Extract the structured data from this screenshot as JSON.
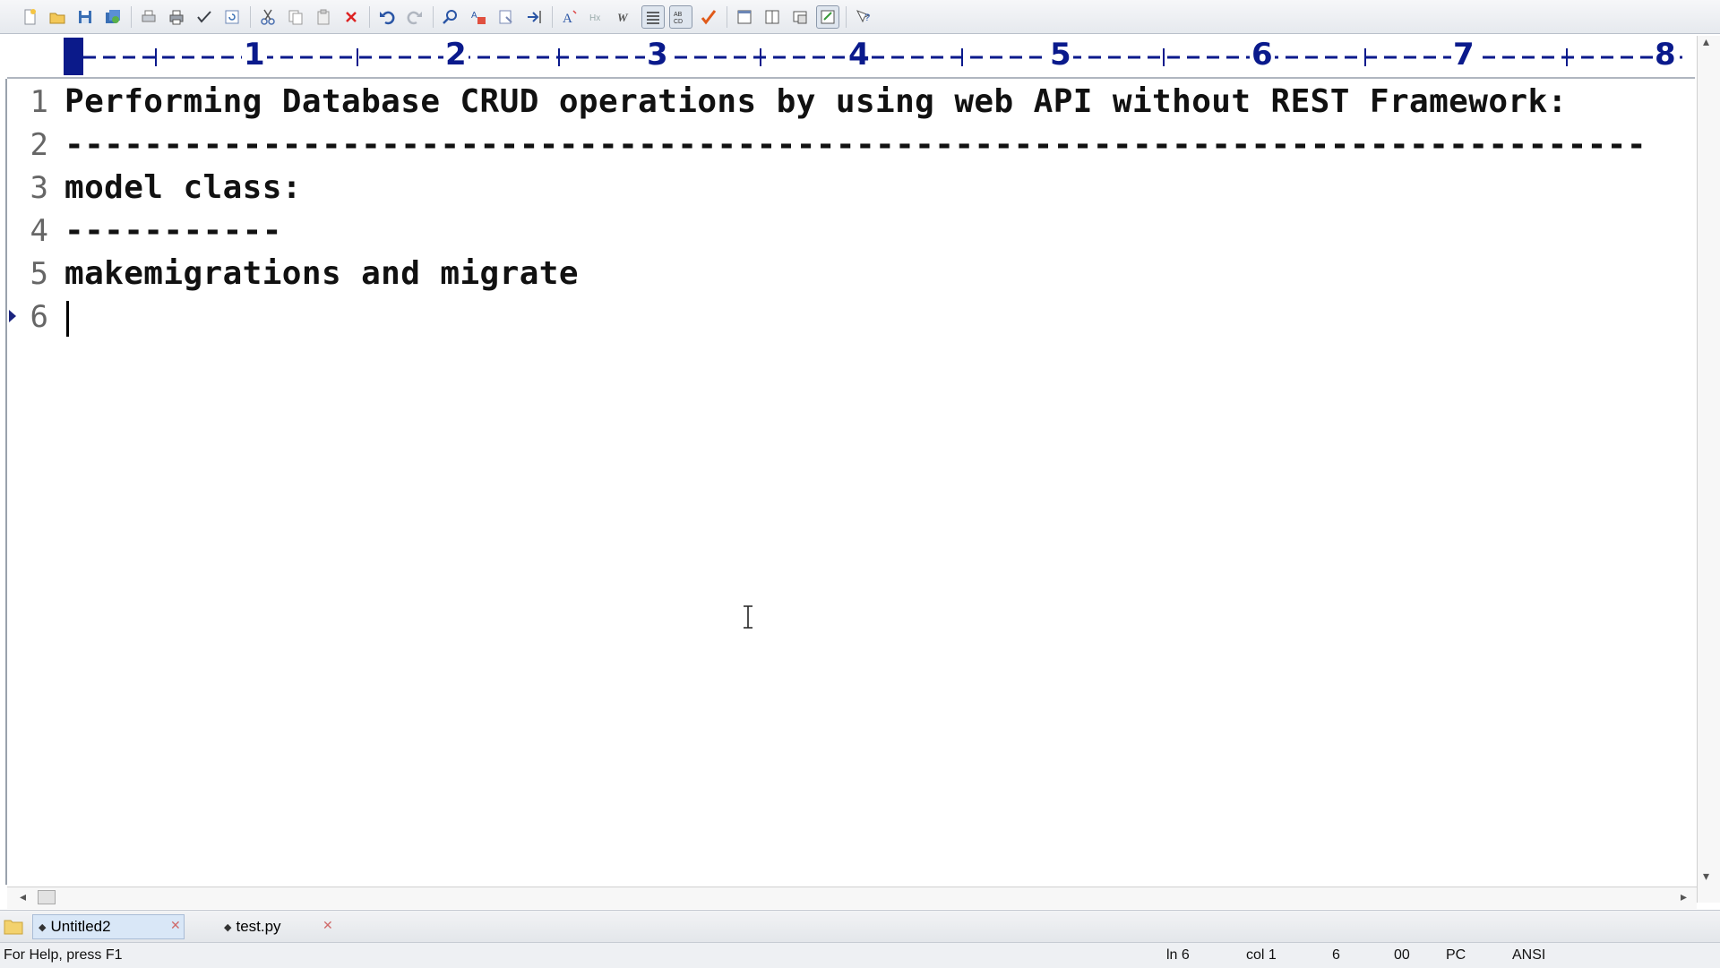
{
  "toolbar": {
    "buttons": [
      {
        "name": "new-file-icon"
      },
      {
        "name": "open-folder-icon"
      },
      {
        "name": "save-icon"
      },
      {
        "name": "save-all-icon"
      },
      {
        "name": "print-preview-icon"
      },
      {
        "name": "print-icon"
      },
      {
        "name": "spell-check-icon"
      },
      {
        "name": "refresh-icon"
      },
      {
        "name": "cut-icon"
      },
      {
        "name": "copy-icon"
      },
      {
        "name": "paste-icon"
      },
      {
        "name": "delete-icon"
      },
      {
        "name": "undo-icon"
      },
      {
        "name": "redo-icon"
      },
      {
        "name": "find-icon"
      },
      {
        "name": "replace-icon"
      },
      {
        "name": "find-in-files-icon"
      },
      {
        "name": "goto-line-icon"
      },
      {
        "name": "font-icon"
      },
      {
        "name": "hex-icon"
      },
      {
        "name": "word-wrap-icon"
      },
      {
        "name": "line-numbers-icon"
      },
      {
        "name": "column-mode-icon"
      },
      {
        "name": "check-icon"
      },
      {
        "name": "window-layout-icon"
      },
      {
        "name": "split-window-icon"
      },
      {
        "name": "tile-window-icon"
      },
      {
        "name": "cascade-window-icon"
      },
      {
        "name": "help-icon"
      }
    ]
  },
  "ruler": {
    "numbers": [
      "1",
      "2",
      "3",
      "4",
      "5",
      "6",
      "7",
      "8"
    ]
  },
  "editor": {
    "lines": [
      {
        "num": "1",
        "text": "Performing Database CRUD operations by using web API without REST Framework:"
      },
      {
        "num": "2",
        "text": "--------------------------------------------------------------------------------"
      },
      {
        "num": "3",
        "text": "model class:"
      },
      {
        "num": "4",
        "text": "-----------"
      },
      {
        "num": "5",
        "text": "makemigrations and migrate"
      },
      {
        "num": "6",
        "text": ""
      }
    ]
  },
  "tabs": [
    {
      "label": "Untitled2",
      "active": true
    },
    {
      "label": "test.py",
      "active": false
    }
  ],
  "status": {
    "help": "For Help, press F1",
    "line": "ln 6",
    "col": "col 1",
    "chars": "6",
    "code": "00",
    "format": "PC",
    "encoding": "ANSI"
  }
}
